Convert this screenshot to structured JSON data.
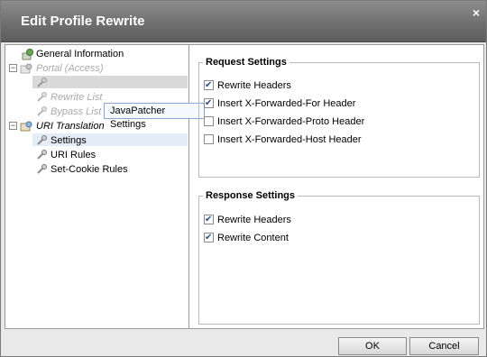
{
  "dialog": {
    "title": "Edit Profile Rewrite",
    "close_glyph": "×"
  },
  "tree": {
    "items": [
      {
        "label": "General Information",
        "icon": "settings-icon"
      },
      {
        "label": "Portal (Access)",
        "icon": "folder-settings-icon"
      },
      {
        "label": "",
        "icon": "settings-icon"
      },
      {
        "label": "Rewrite List",
        "icon": "settings-icon"
      },
      {
        "label": "Bypass List",
        "icon": "settings-icon"
      },
      {
        "label": "URI Translation",
        "icon": "folder-settings-icon"
      },
      {
        "label": "Settings",
        "icon": "settings-icon"
      },
      {
        "label": "URI Rules",
        "icon": "settings-icon"
      },
      {
        "label": "Set-Cookie Rules",
        "icon": "settings-icon"
      }
    ],
    "tooltip": {
      "title": "JavaPatcher",
      "subtitle": "Settings"
    }
  },
  "request_settings": {
    "legend": "Request Settings",
    "options": [
      {
        "label": "Rewrite Headers",
        "checked": true
      },
      {
        "label": "Insert X-Forwarded-For Header",
        "checked": true
      },
      {
        "label": "Insert X-Forwarded-Proto Header",
        "checked": false
      },
      {
        "label": "Insert X-Forwarded-Host Header",
        "checked": false
      }
    ]
  },
  "response_settings": {
    "legend": "Response Settings",
    "options": [
      {
        "label": "Rewrite Headers",
        "checked": true
      },
      {
        "label": "Rewrite Content",
        "checked": true
      }
    ]
  },
  "buttons": {
    "ok": "OK",
    "cancel": "Cancel"
  }
}
